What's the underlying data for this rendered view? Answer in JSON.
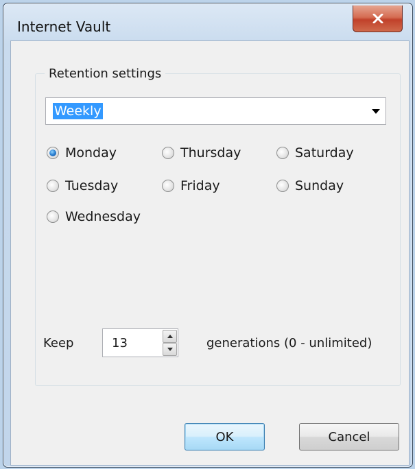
{
  "window": {
    "title": "Internet Vault",
    "close_icon": "close-x-icon"
  },
  "retention": {
    "group_label": "Retention settings",
    "frequency": {
      "selected": "Weekly"
    },
    "days": [
      {
        "label": "Monday",
        "checked": true
      },
      {
        "label": "Thursday",
        "checked": false
      },
      {
        "label": "Saturday",
        "checked": false
      },
      {
        "label": "Tuesday",
        "checked": false
      },
      {
        "label": "Friday",
        "checked": false
      },
      {
        "label": "Sunday",
        "checked": false
      },
      {
        "label": "Wednesday",
        "checked": false
      }
    ],
    "keep_label": "Keep",
    "generations_value": "13",
    "generations_label": "generations (0 - unlimited)"
  },
  "buttons": {
    "ok": "OK",
    "cancel": "Cancel"
  },
  "colors": {
    "selection": "#3399ff",
    "close_button": "#c1412a",
    "default_button_border": "#3c7fb1"
  }
}
